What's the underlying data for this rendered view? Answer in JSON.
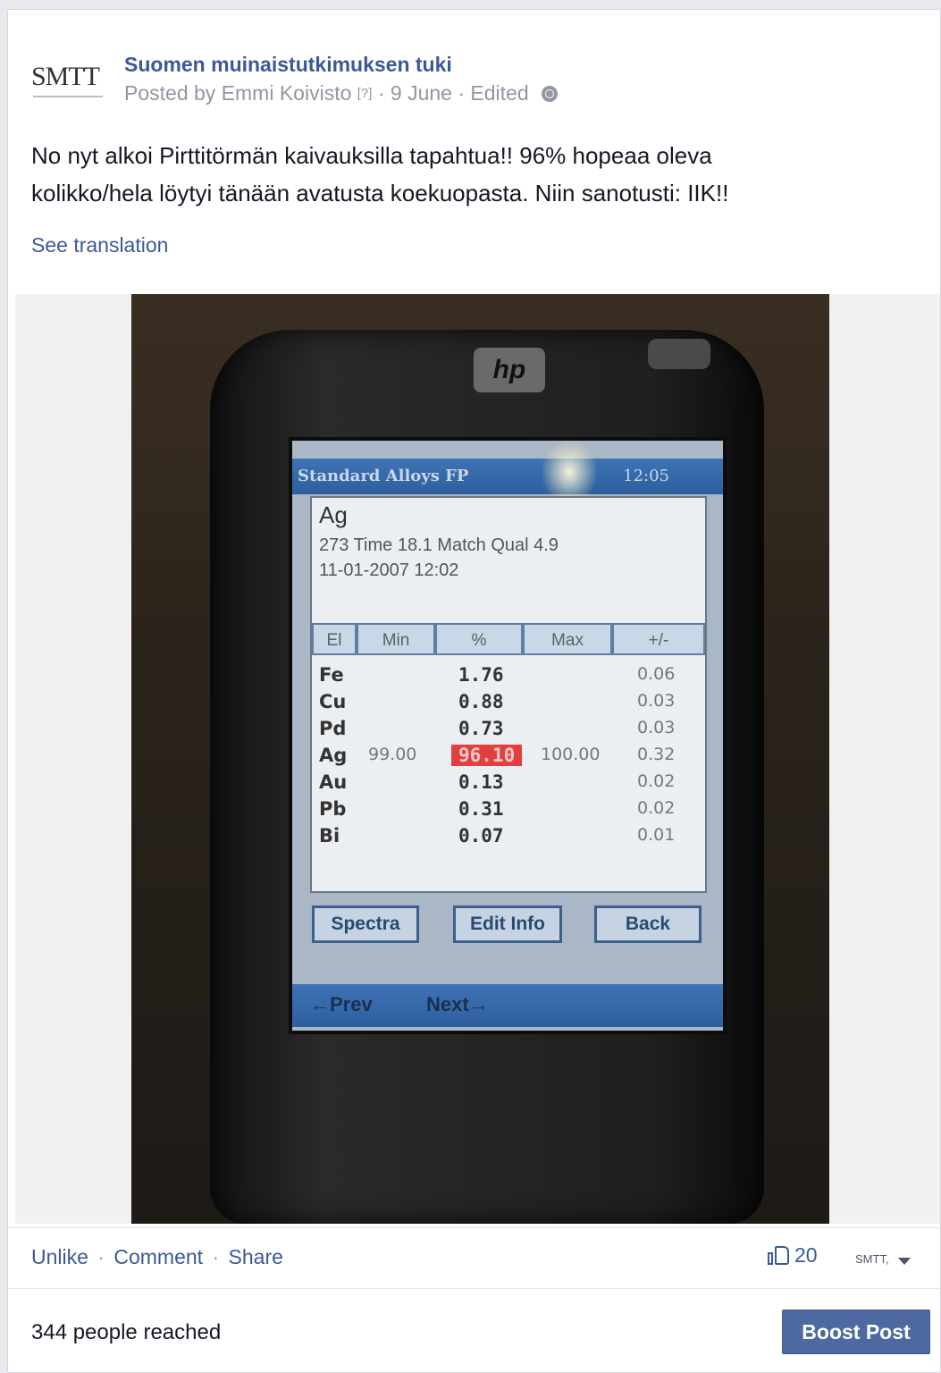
{
  "post": {
    "page_name": "Suomen muinaistutkimuksen tuki",
    "logo_text": "SMTT",
    "posted_by": "Posted by Emmi Koivisto",
    "help_marker": "[?]",
    "date": "· 9 June · Edited",
    "text_line1": "No nyt alkoi Pirttitörmän kaivauksilla tapahtua!! 96% hopeaa oleva",
    "text_line2": "kolikko/hela löytyi tänään avatusta koekuopasta. Niin sanotusti: IIK!!",
    "see_translation": "See translation"
  },
  "photo": {
    "device_brand": "hp",
    "app_title": "Standard Alloys FP",
    "clock": "12:05",
    "alloy": "Ag",
    "info_line1": "273 Time   18.1 Match Qual  4.9",
    "info_line2": "11-01-2007 12:02",
    "columns": [
      "El",
      "Min",
      "%",
      "Max",
      "+/-"
    ],
    "rows": [
      {
        "el": "Fe",
        "min": "",
        "pct": "1.76",
        "max": "",
        "pm": "0.06"
      },
      {
        "el": "Cu",
        "min": "",
        "pct": "0.88",
        "max": "",
        "pm": "0.03"
      },
      {
        "el": "Pd",
        "min": "",
        "pct": "0.73",
        "max": "",
        "pm": "0.03"
      },
      {
        "el": "Ag",
        "min": "99.00",
        "pct": "96.10",
        "max": "100.00",
        "pm": "0.32"
      },
      {
        "el": "Au",
        "min": "",
        "pct": "0.13",
        "max": "",
        "pm": "0.02"
      },
      {
        "el": "Pb",
        "min": "",
        "pct": "0.31",
        "max": "",
        "pm": "0.02"
      },
      {
        "el": "Bi",
        "min": "",
        "pct": "0.07",
        "max": "",
        "pm": "0.01"
      }
    ],
    "buttons": {
      "spectra": "Spectra",
      "edit_info": "Edit Info",
      "back": "Back"
    },
    "nav": {
      "prev": "←Prev",
      "next": "Next→"
    }
  },
  "actions": {
    "unlike": "Unlike",
    "comment": "Comment",
    "share": "Share",
    "separator": "·",
    "like_count": "20",
    "actor": "SMTT,"
  },
  "footer": {
    "reached": "344 people reached",
    "boost": "Boost Post"
  },
  "colors": {
    "link": "#3b5998",
    "boost": "#4e69a2",
    "highlight": "#e04040"
  }
}
